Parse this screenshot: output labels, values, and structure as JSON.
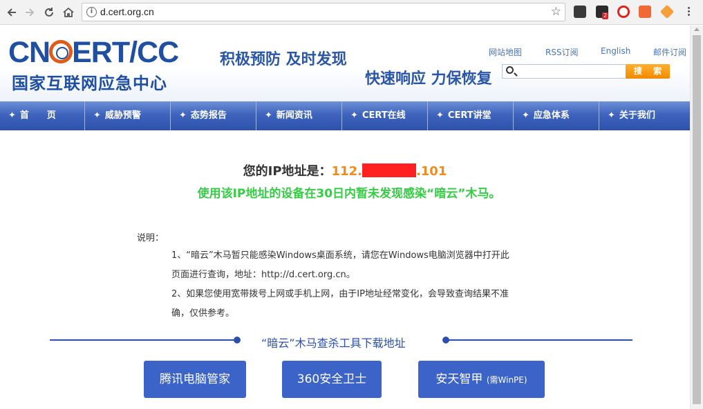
{
  "browser": {
    "url": "d.cert.org.cn",
    "extension_badge": "2"
  },
  "header": {
    "logo_top_left": "CN",
    "logo_top_right": "ERT/CC",
    "logo_bottom": "国家互联网应急中心",
    "slogan1": "积极预防 及时发现",
    "slogan2": "快速响应 力保恢复",
    "links": [
      "网站地图",
      "RSS订阅",
      "English",
      "邮件订阅"
    ],
    "search_button": "搜 索",
    "search_placeholder": ""
  },
  "menu": {
    "items": [
      "首　　页",
      "威胁预警",
      "态势报告",
      "新闻资讯",
      "CERT在线",
      "CERT讲堂",
      "应急体系",
      "关于我们"
    ]
  },
  "result": {
    "ip_label": "您的IP地址是：",
    "ip_prefix": "112.",
    "ip_suffix": ".101",
    "status": "使用该IP地址的设备在30日内暂未发现感染“暗云”木马。"
  },
  "notes": {
    "title": "说明：",
    "lines": [
      "1、“暗云”木马暂只能感染Windows桌面系统，请您在Windows电脑浏览器中打开此",
      "页面进行查询，地址：http://d.cert.org.cn。",
      "2、如果您使用宽带拨号上网或手机上网，由于IP地址经常变化，会导致查询结果不准",
      "确，仅供参考。"
    ]
  },
  "downloads": {
    "title": "“暗云”木马查杀工具下载地址",
    "buttons": [
      {
        "label": "腾讯电脑管家",
        "note": ""
      },
      {
        "label": "360安全卫士",
        "note": ""
      },
      {
        "label": "安天智甲 ",
        "note": "(需WinPE)"
      }
    ]
  },
  "colors": {
    "brand_blue": "#1e4fa3",
    "ip_orange": "#f18c1a",
    "status_green": "#34cd44",
    "button_blue": "#3c63c7"
  }
}
